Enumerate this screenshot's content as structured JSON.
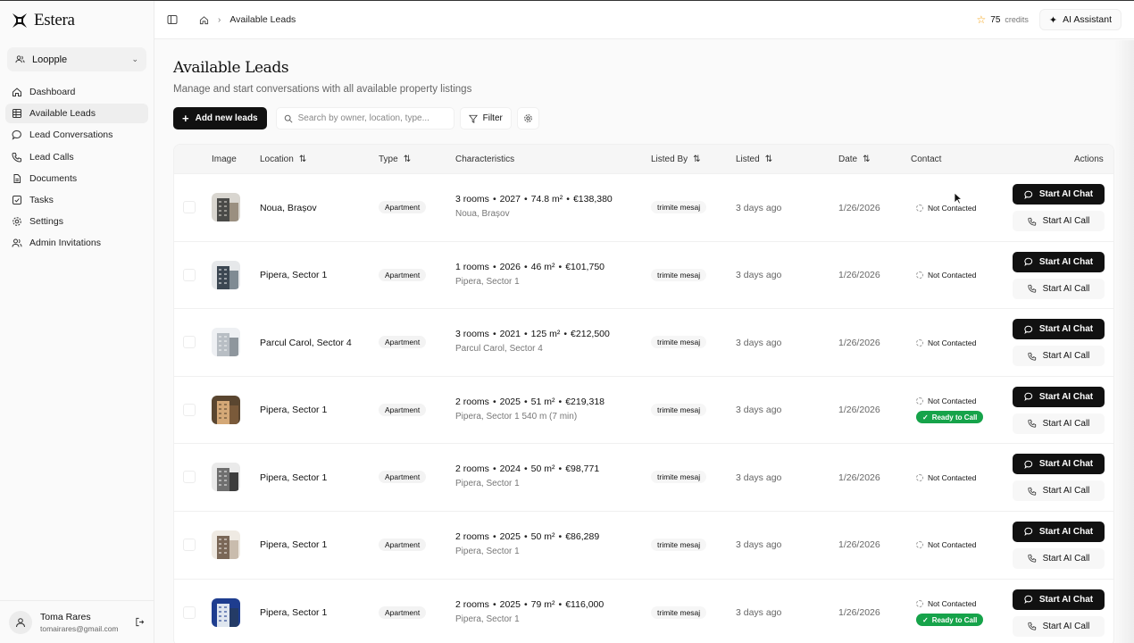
{
  "brand": {
    "name": "Estera"
  },
  "workspace": {
    "name": "Loopple"
  },
  "sidebar": {
    "items": [
      {
        "label": "Dashboard",
        "icon": "home-icon",
        "active": false
      },
      {
        "label": "Available Leads",
        "icon": "table-icon",
        "active": true
      },
      {
        "label": "Lead Conversations",
        "icon": "chat-icon",
        "active": false
      },
      {
        "label": "Lead Calls",
        "icon": "phone-icon",
        "active": false
      },
      {
        "label": "Documents",
        "icon": "document-icon",
        "active": false
      },
      {
        "label": "Tasks",
        "icon": "checkbox-icon",
        "active": false
      },
      {
        "label": "Settings",
        "icon": "gear-icon",
        "active": false
      },
      {
        "label": "Admin Invitations",
        "icon": "users-icon",
        "active": false
      }
    ]
  },
  "user": {
    "name": "Toma Rares",
    "email": "tomairares@gmail.com"
  },
  "topbar": {
    "breadcrumb": "Available Leads",
    "credits_value": "75",
    "credits_label": "credits",
    "ai_assistant": "AI Assistant"
  },
  "page": {
    "title": "Available Leads",
    "subtitle": "Manage and start conversations with all available property listings"
  },
  "toolbar": {
    "add_label": "Add new leads",
    "search_placeholder": "Search by owner, location, type...",
    "filter_label": "Filter"
  },
  "table": {
    "columns": {
      "image": "Image",
      "location": "Location",
      "type": "Type",
      "characteristics": "Characteristics",
      "listed_by": "Listed By",
      "listed": "Listed",
      "date": "Date",
      "contact": "Contact",
      "actions": "Actions"
    },
    "chat_label": "Start AI Chat",
    "call_label": "Start AI Call",
    "rows": [
      {
        "location": "Noua, Brașov",
        "type": "Apartment",
        "rooms": "3 rooms",
        "year": "2027",
        "area": "74.8 m²",
        "price": "€138,380",
        "sub": "Noua, Brașov",
        "listed_by": "trimite mesaj",
        "listed": "3 days ago",
        "date": "1/26/2026",
        "status": "Not Contacted",
        "ready": ""
      },
      {
        "location": "Pipera, Sector 1",
        "type": "Apartment",
        "rooms": "1 rooms",
        "year": "2026",
        "area": "46 m²",
        "price": "€101,750",
        "sub": "Pipera, Sector 1",
        "listed_by": "trimite mesaj",
        "listed": "3 days ago",
        "date": "1/26/2026",
        "status": "Not Contacted",
        "ready": ""
      },
      {
        "location": "Parcul Carol, Sector 4",
        "type": "Apartment",
        "rooms": "3 rooms",
        "year": "2021",
        "area": "125 m²",
        "price": "€212,500",
        "sub": "Parcul Carol, Sector 4",
        "listed_by": "trimite mesaj",
        "listed": "3 days ago",
        "date": "1/26/2026",
        "status": "Not Contacted",
        "ready": ""
      },
      {
        "location": "Pipera, Sector 1",
        "type": "Apartment",
        "rooms": "2 rooms",
        "year": "2025",
        "area": "51 m²",
        "price": "€219,318",
        "sub": "Pipera, Sector 1 540 m (7 min)",
        "listed_by": "trimite mesaj",
        "listed": "3 days ago",
        "date": "1/26/2026",
        "status": "Not Contacted",
        "ready": "Ready to Call"
      },
      {
        "location": "Pipera, Sector 1",
        "type": "Apartment",
        "rooms": "2 rooms",
        "year": "2024",
        "area": "50 m²",
        "price": "€98,771",
        "sub": "Pipera, Sector 1",
        "listed_by": "trimite mesaj",
        "listed": "3 days ago",
        "date": "1/26/2026",
        "status": "Not Contacted",
        "ready": ""
      },
      {
        "location": "Pipera, Sector 1",
        "type": "Apartment",
        "rooms": "2 rooms",
        "year": "2025",
        "area": "50 m²",
        "price": "€86,289",
        "sub": "Pipera, Sector 1",
        "listed_by": "trimite mesaj",
        "listed": "3 days ago",
        "date": "1/26/2026",
        "status": "Not Contacted",
        "ready": ""
      },
      {
        "location": "Pipera, Sector 1",
        "type": "Apartment",
        "rooms": "2 rooms",
        "year": "2025",
        "area": "79 m²",
        "price": "€116,000",
        "sub": "Pipera, Sector 1",
        "listed_by": "trimite mesaj",
        "listed": "3 days ago",
        "date": "1/26/2026",
        "status": "Not Contacted",
        "ready": "Ready to Call"
      }
    ]
  },
  "colors": {
    "accent": "#111111",
    "ready": "#16a34a",
    "star": "#f59e0b"
  }
}
